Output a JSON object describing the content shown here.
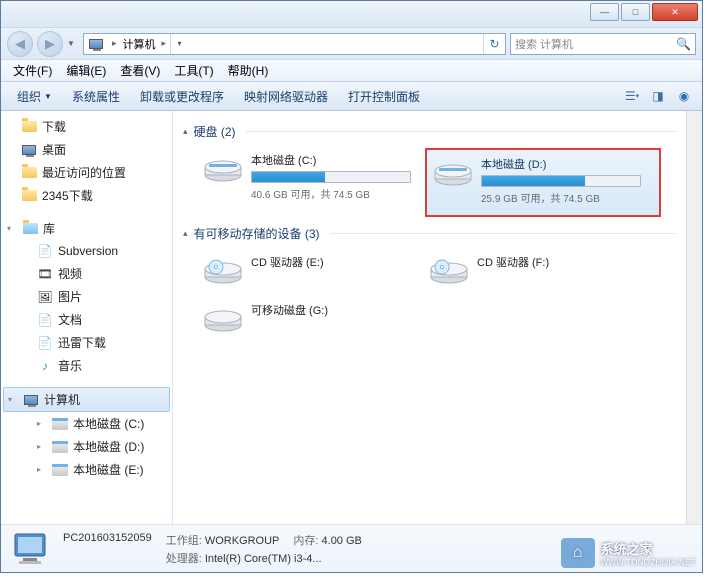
{
  "window_controls": {
    "min": "—",
    "max": "□",
    "close": "✕"
  },
  "address": {
    "root": "计算机",
    "refresh_icon": "↻"
  },
  "search": {
    "placeholder": "搜索 计算机"
  },
  "menubar": {
    "file": "文件(F)",
    "edit": "编辑(E)",
    "view": "查看(V)",
    "tools": "工具(T)",
    "help": "帮助(H)"
  },
  "toolbar": {
    "organize": "组织",
    "sysprops": "系统属性",
    "uninstall": "卸载或更改程序",
    "mapnet": "映射网络驱动器",
    "controlpanel": "打开控制面板"
  },
  "sidebar": {
    "downloads": "下载",
    "desktop": "桌面",
    "recent": "最近访问的位置",
    "dir2345": "2345下载",
    "libraries": "库",
    "subversion": "Subversion",
    "videos": "视频",
    "pictures": "图片",
    "documents": "文档",
    "xunlei": "迅雷下载",
    "music": "音乐",
    "computer": "计算机",
    "disk_c": "本地磁盘 (C:)",
    "disk_d": "本地磁盘 (D:)",
    "disk_e": "本地磁盘 (E:)"
  },
  "categories": {
    "hdd": "硬盘 (2)",
    "removable": "有可移动存储的设备 (3)"
  },
  "drives": {
    "c": {
      "name": "本地磁盘 (C:)",
      "sub": "40.6 GB 可用，共 74.5 GB",
      "pct": 46
    },
    "d": {
      "name": "本地磁盘 (D:)",
      "sub": "25.9 GB 可用，共 74.5 GB",
      "pct": 65
    },
    "cd_e": {
      "name": "CD 驱动器 (E:)"
    },
    "cd_f": {
      "name": "CD 驱动器 (F:)"
    },
    "rem_g": {
      "name": "可移动磁盘 (G:)"
    }
  },
  "details": {
    "name": "PC201603152059",
    "workgroup_label": "工作组:",
    "workgroup": "WORKGROUP",
    "cpu_label": "处理器:",
    "cpu": "Intel(R) Core(TM) i3-4...",
    "mem_label": "内存:",
    "mem": "4.00 GB"
  },
  "watermark": {
    "text": "系统之家",
    "url": "WWW.TONGZHIJIA.NET"
  }
}
